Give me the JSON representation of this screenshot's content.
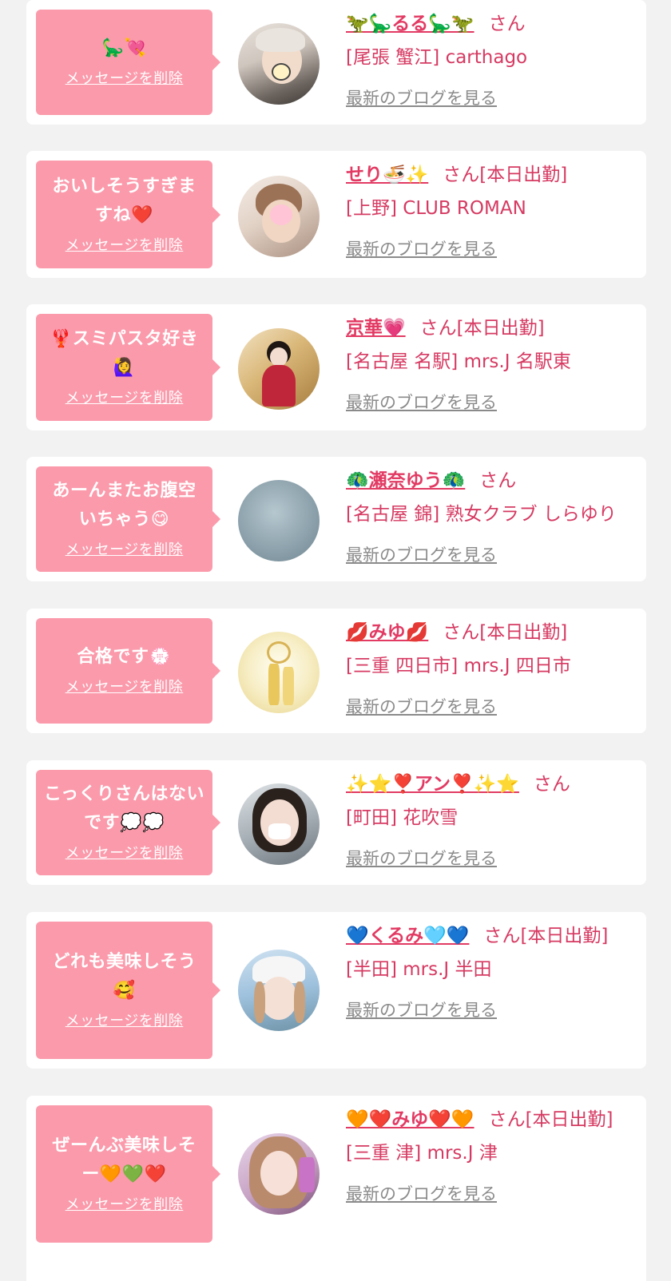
{
  "colors": {
    "background": "#f2f2f2",
    "card": "#ffffff",
    "bubble": "#fb9aab",
    "name": "#e23a63",
    "shop_text": "#d63a62",
    "blog_link": "#8a8a8a"
  },
  "entries": [
    {
      "message": "🦕💘",
      "delete_label": "メッセージを削除",
      "name": "🦖🦕るる🦕🦖",
      "suffix": "さん",
      "shop": "[尾張 蟹江] carthago",
      "blog_link": "最新のブログを見る"
    },
    {
      "message": "おいしそうすぎますね❤️",
      "delete_label": "メッセージを削除",
      "name": "せり🍜✨",
      "suffix": "さん[本日出勤]",
      "shop": "[上野] CLUB ROMAN",
      "blog_link": "最新のブログを見る"
    },
    {
      "message": "🦞スミパスタ好き🙋‍♀️",
      "delete_label": "メッセージを削除",
      "name": "京華💗",
      "suffix": "さん[本日出勤]",
      "shop": "[名古屋 名駅] mrs.J 名駅東",
      "blog_link": "最新のブログを見る"
    },
    {
      "message": "あーんまたお腹空いちゃう😋",
      "delete_label": "メッセージを削除",
      "name": "🦚瀬奈ゆう🦚",
      "suffix": "さん",
      "shop": "[名古屋 錦] 熟女クラブ しらゆり",
      "blog_link": "最新のブログを見る"
    },
    {
      "message": "合格です💮",
      "delete_label": "メッセージを削除",
      "name": "💋みゆ💋",
      "suffix": "さん[本日出勤]",
      "shop": "[三重 四日市] mrs.J 四日市",
      "blog_link": "最新のブログを見る"
    },
    {
      "message": "こっくりさんはないです💭💭",
      "delete_label": "メッセージを削除",
      "name": "✨⭐❣️アン❣️✨⭐",
      "suffix": "さん",
      "shop": "[町田] 花吹雪",
      "blog_link": "最新のブログを見る"
    },
    {
      "message": "どれも美味しそう🥰",
      "delete_label": "メッセージを削除",
      "name": "💙くるみ🩵💙",
      "suffix": "さん[本日出勤]",
      "shop": "[半田] mrs.J 半田",
      "blog_link": "最新のブログを見る"
    },
    {
      "message": "ぜーんぶ美味しそー🧡💚❤️",
      "delete_label": "メッセージを削除",
      "name": "🧡❤️みゆ❤️🧡",
      "suffix": "さん[本日出勤]",
      "shop": "[三重 津] mrs.J 津",
      "blog_link": "最新のブログを見る"
    }
  ]
}
